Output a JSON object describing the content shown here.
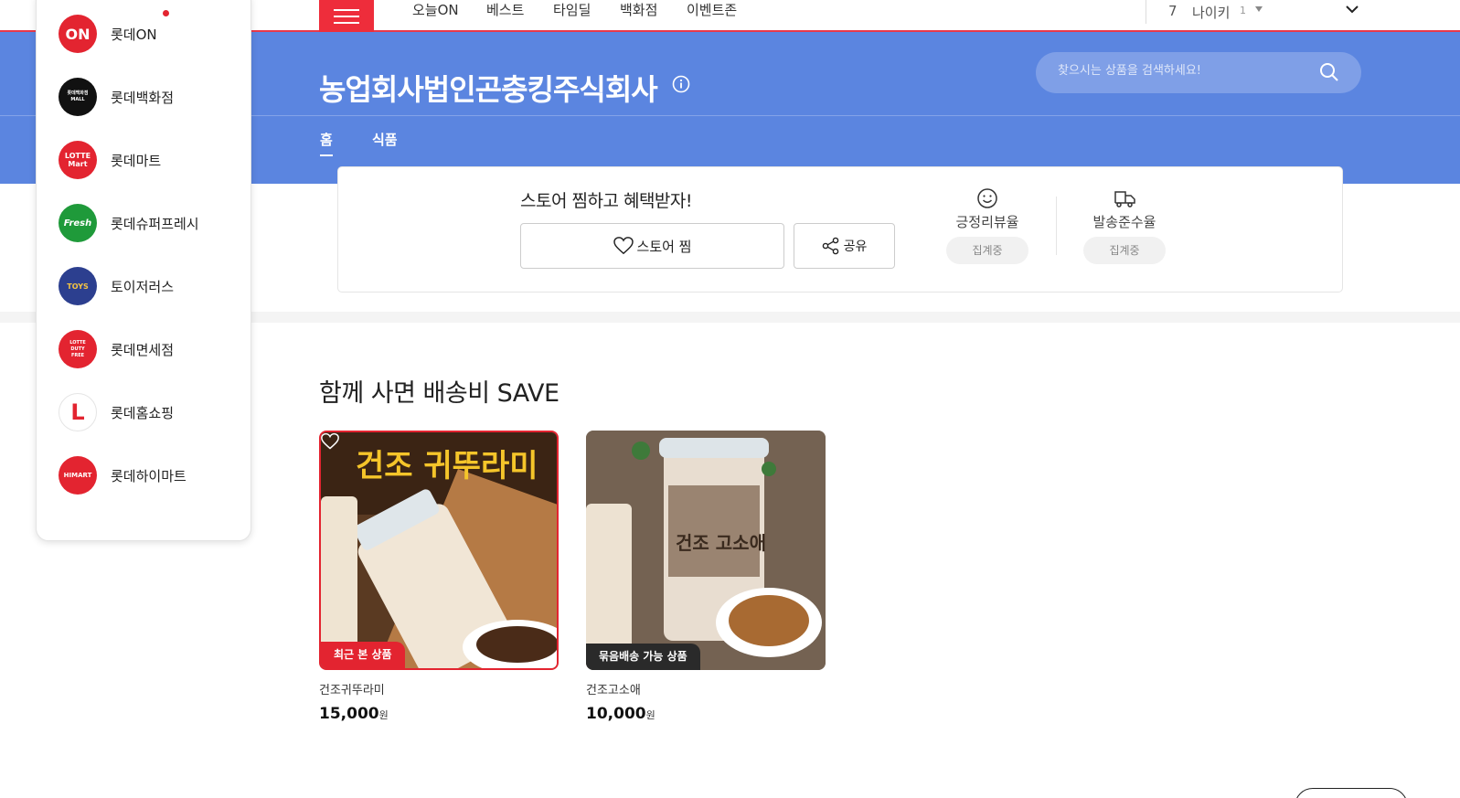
{
  "top_nav": {
    "items": [
      "오늘ON",
      "베스트",
      "타임딜",
      "백화점",
      "이벤트존"
    ],
    "ranking": {
      "rank": "7",
      "keyword": "나이키",
      "change": "1"
    }
  },
  "store": {
    "name": "농업회사법인곤충킹주식회사",
    "search_placeholder": "찾으시는 상품을 검색하세요!",
    "tabs": [
      "홈",
      "식품"
    ]
  },
  "store_card": {
    "promo": "스토어 찜하고 혜택받자!",
    "wish_label": "스토어 찜",
    "share_label": "공유",
    "stats": [
      {
        "label": "긍정리뷰율",
        "value": "집계중",
        "icon": "smile-icon"
      },
      {
        "label": "발송준수율",
        "value": "집계중",
        "icon": "truck-icon"
      }
    ]
  },
  "section": {
    "title": "함께 사면 배송비 SAVE",
    "products": [
      {
        "name": "건조귀뚜라미",
        "price": "15,000",
        "currency": "원",
        "badge": "최근 본 상품",
        "image_text": "건조 귀뚜라미"
      },
      {
        "name": "건조고소애",
        "price": "10,000",
        "currency": "원",
        "badge": "묶음배송 가능 상품",
        "image_text": "건조 고소애"
      }
    ]
  },
  "side_menu": {
    "items": [
      {
        "label": "롯데ON",
        "logo": "ON",
        "color": "#e32430"
      },
      {
        "label": "롯데백화점",
        "logo": "롯데백화점 MALL",
        "color": "#111111"
      },
      {
        "label": "롯데마트",
        "logo": "LOTTE Mart",
        "color": "#e32430"
      },
      {
        "label": "롯데슈퍼프레시",
        "logo": "Fresh",
        "color": "#1f9a3a"
      },
      {
        "label": "토이저러스",
        "logo": "TOYS",
        "color": "#2c3f8f"
      },
      {
        "label": "롯데면세점",
        "logo": "LOTTE DUTY FREE",
        "color": "#e32430"
      },
      {
        "label": "롯데홈쇼핑",
        "logo": "L",
        "color": "#ffffff"
      },
      {
        "label": "롯데하이마트",
        "logo": "HIMART",
        "color": "#e32430"
      }
    ]
  },
  "colors": {
    "header_blue": "#5b85e0",
    "accent_red": "#e32430"
  }
}
